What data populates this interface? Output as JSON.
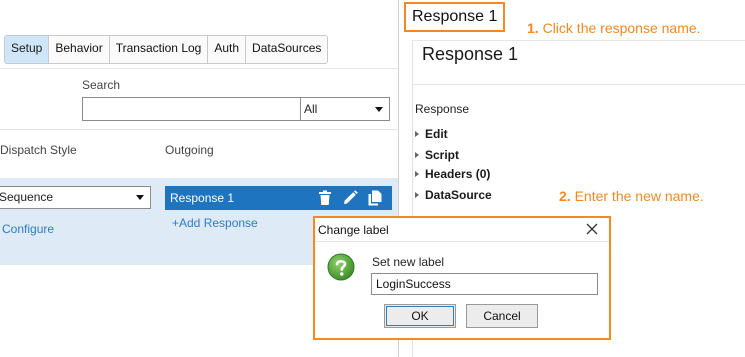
{
  "tabs": [
    {
      "label": "Setup",
      "active": true
    },
    {
      "label": "Behavior",
      "active": false
    },
    {
      "label": "Transaction Log",
      "active": false
    },
    {
      "label": "Auth",
      "active": false
    },
    {
      "label": "DataSources",
      "active": false
    }
  ],
  "search": {
    "label": "Search",
    "value": "",
    "filter_selected": "All"
  },
  "columns": {
    "dispatch_style": "Dispatch Style",
    "outgoing": "Outgoing"
  },
  "dispatch": {
    "selected": "Sequence",
    "configure_label": "Configure"
  },
  "outgoing": {
    "response_label": "Response 1",
    "add_response_label": "+Add Response"
  },
  "right_panel": {
    "name_box": "Response 1",
    "title": "Response 1",
    "section_label": "Response",
    "tree_items": [
      "Edit",
      "Script",
      "Headers (0)",
      "DataSource"
    ]
  },
  "callouts": {
    "step1_number": "1.",
    "step1_text": "Click the response name.",
    "step2_number": "2.",
    "step2_text": "Enter the new name."
  },
  "dialog": {
    "title": "Change label",
    "prompt": "Set new label",
    "value": "LoginSuccess",
    "ok_label": "OK",
    "cancel_label": "Cancel"
  },
  "colors": {
    "accent_orange": "#f08a24",
    "selected_blue": "#1f74c0",
    "row_highlight": "#deebf7",
    "tab_active": "#cfe6f8",
    "link_blue": "#2f7bc4",
    "question_green": "#5aa83a"
  }
}
